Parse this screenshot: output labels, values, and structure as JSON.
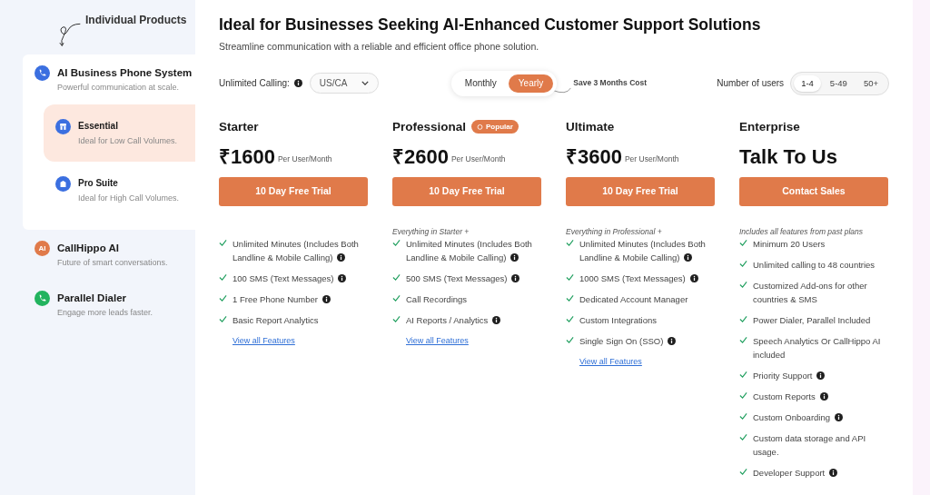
{
  "sidebar": {
    "heading": "Individual Products",
    "products": [
      {
        "kind": "phone",
        "title": "AI Business Phone System",
        "subtitle": "Powerful communication at scale.",
        "selected": true,
        "children": [
          {
            "kind": "store",
            "title": "Essential",
            "subtitle": "Ideal for Low Call Volumes.",
            "selected": true
          },
          {
            "kind": "building",
            "title": "Pro Suite",
            "subtitle": "Ideal for High Call Volumes.",
            "selected": false
          }
        ]
      },
      {
        "kind": "ai",
        "badge": "AI",
        "title": "CallHippo AI",
        "subtitle": "Future of smart conversations.",
        "selected": false
      },
      {
        "kind": "dialer",
        "title": "Parallel Dialer",
        "subtitle": "Engage more leads faster.",
        "selected": false
      }
    ]
  },
  "header": {
    "title": "Ideal for Businesses Seeking AI-Enhanced Customer Support Solutions",
    "subtitle": "Streamline communication with a reliable and efficient office phone solution."
  },
  "controls": {
    "calling_label": "Unlimited Calling:",
    "region": "US/CA",
    "billing": [
      {
        "label": "Monthly",
        "selected": false
      },
      {
        "label": "Yearly",
        "selected": true
      }
    ],
    "billing_note": "Save 3 Months Cost",
    "users_label": "Number of users",
    "users": [
      {
        "label": "1-4",
        "selected": true
      },
      {
        "label": "5-49",
        "selected": false
      },
      {
        "label": "50+",
        "selected": false
      }
    ]
  },
  "plans": [
    {
      "name": "Starter",
      "price": "₹1600",
      "unit": "Per User/Month",
      "button": "10 Day Free Trial",
      "features": [
        {
          "text": "Unlimited Minutes (Includes Both Landline & Mobile Calling)",
          "info": true
        },
        {
          "text": "100 SMS (Text Messages)",
          "info": true
        },
        {
          "text": "1 Free Phone Number",
          "info": true
        },
        {
          "text": "Basic Report Analytics",
          "info": false
        }
      ],
      "link": "View all Features"
    },
    {
      "name": "Professional",
      "badge": "Popular",
      "price": "₹2600",
      "unit": "Per User/Month",
      "button": "10 Day Free Trial",
      "note": "Everything in Starter +",
      "features": [
        {
          "text": "Unlimited Minutes (Includes Both Landline & Mobile Calling)",
          "info": true
        },
        {
          "text": "500 SMS (Text Messages)",
          "info": true
        },
        {
          "text": "Call Recordings",
          "info": false
        },
        {
          "text": "AI Reports / Analytics",
          "info": true
        }
      ],
      "link": "View all Features"
    },
    {
      "name": "Ultimate",
      "price": "₹3600",
      "unit": "Per User/Month",
      "button": "10 Day Free Trial",
      "note": "Everything in Professional +",
      "features": [
        {
          "text": "Unlimited Minutes (Includes Both Landline & Mobile Calling)",
          "info": true
        },
        {
          "text": "1000 SMS (Text Messages)",
          "info": true
        },
        {
          "text": "Dedicated Account Manager",
          "info": false
        },
        {
          "text": "Custom Integrations",
          "info": false
        },
        {
          "text": "Single Sign On (SSO)",
          "info": true
        }
      ],
      "link": "View all Features"
    },
    {
      "name": "Enterprise",
      "price": "Talk To Us",
      "button": "Contact Sales",
      "note": "Includes all features from past plans",
      "features": [
        {
          "text": "Minimum 20 Users",
          "info": false
        },
        {
          "text": "Unlimited calling to 48 countries",
          "info": false
        },
        {
          "text": "Customized Add-ons for other countries & SMS",
          "info": false
        },
        {
          "text": "Power Dialer, Parallel Included",
          "info": false
        },
        {
          "text": "Speech Analytics Or CallHippo AI included",
          "info": false
        },
        {
          "text": "Priority Support",
          "info": true
        },
        {
          "text": "Custom Reports",
          "info": true
        },
        {
          "text": "Custom Onboarding",
          "info": true
        },
        {
          "text": "Custom data storage and API usage.",
          "info": false
        },
        {
          "text": "Developer Support",
          "info": true
        }
      ]
    }
  ]
}
